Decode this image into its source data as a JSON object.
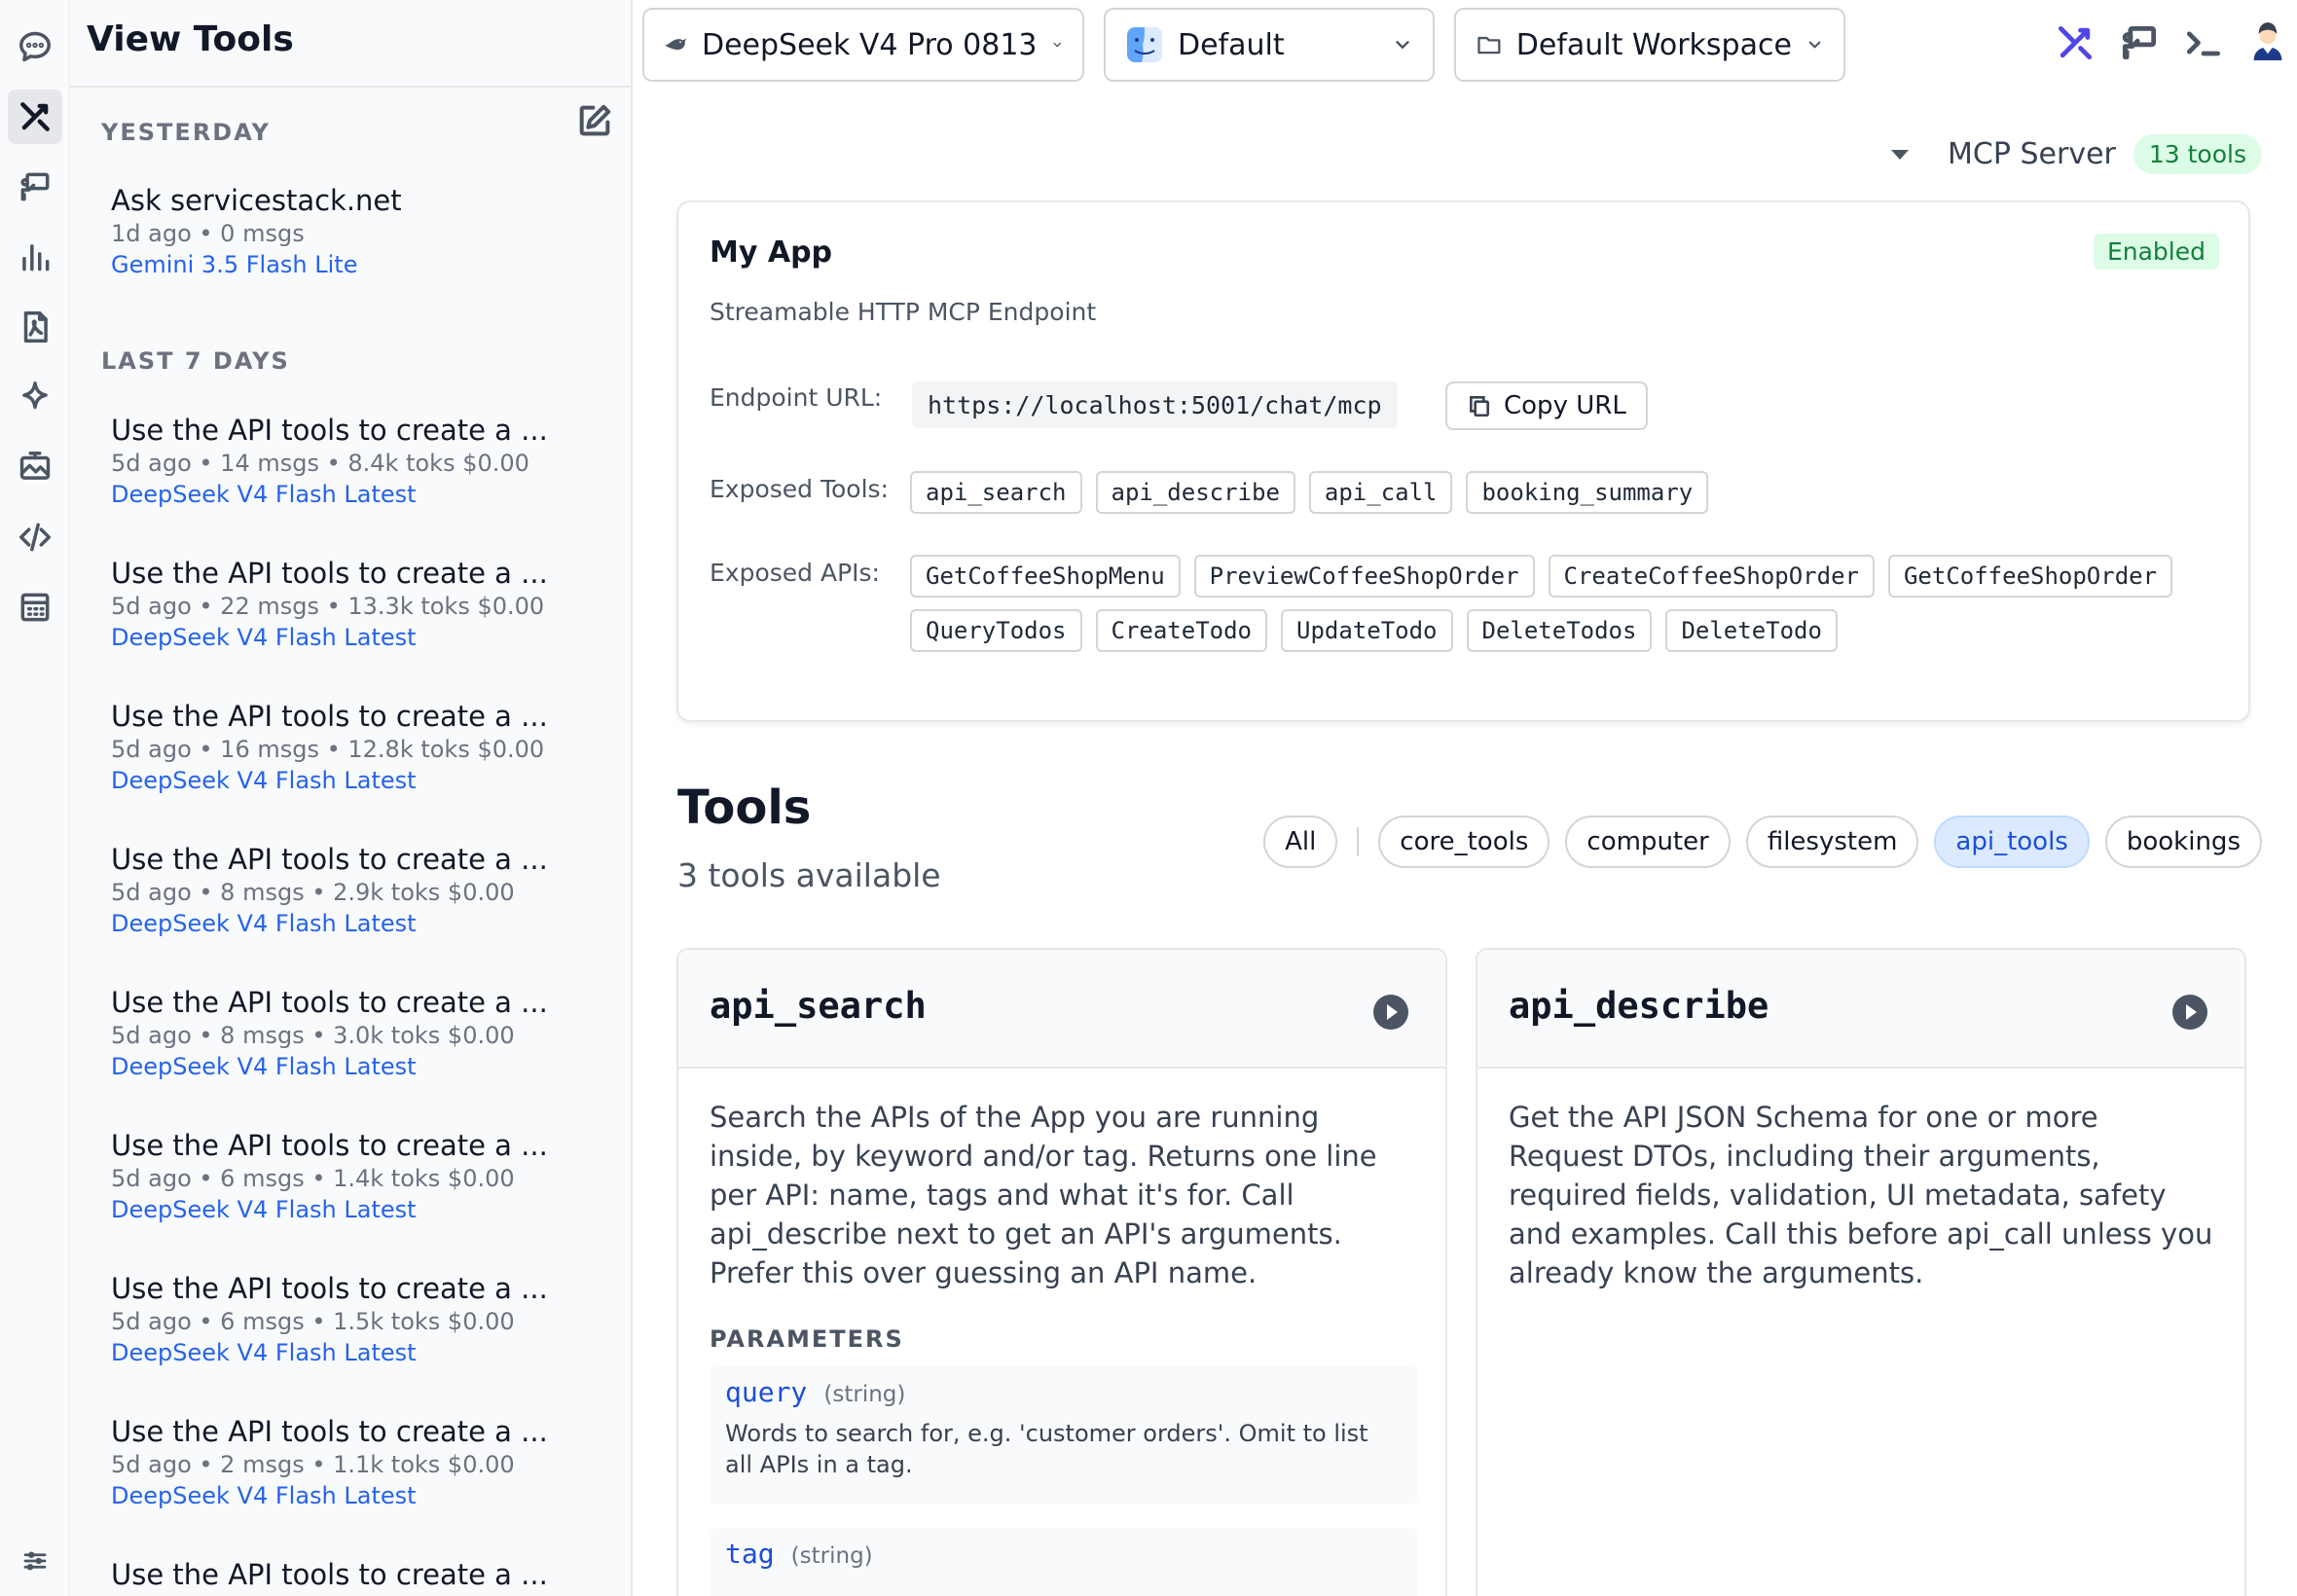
{
  "sidebar": {
    "title": "View Tools",
    "groups": [
      {
        "label": "YESTERDAY"
      },
      {
        "label": "LAST 7 DAYS"
      }
    ],
    "threads": [
      {
        "title": "Ask servicestack.net",
        "meta": "1d ago • 0 msgs",
        "model": "Gemini 3.5 Flash Lite"
      },
      {
        "title": "Use the API tools to create a ...",
        "meta": "5d ago • 14 msgs • 8.4k toks $0.00",
        "model": "DeepSeek V4 Flash Latest"
      },
      {
        "title": "Use the API tools to create a ...",
        "meta": "5d ago • 22 msgs • 13.3k toks $0.00",
        "model": "DeepSeek V4 Flash Latest"
      },
      {
        "title": "Use the API tools to create a ...",
        "meta": "5d ago • 16 msgs • 12.8k toks $0.00",
        "model": "DeepSeek V4 Flash Latest"
      },
      {
        "title": "Use the API tools to create a ...",
        "meta": "5d ago • 8 msgs • 2.9k toks $0.00",
        "model": "DeepSeek V4 Flash Latest"
      },
      {
        "title": "Use the API tools to create a ...",
        "meta": "5d ago • 8 msgs • 3.0k toks $0.00",
        "model": "DeepSeek V4 Flash Latest"
      },
      {
        "title": "Use the API tools to create a ...",
        "meta": "5d ago • 6 msgs • 1.4k toks $0.00",
        "model": "DeepSeek V4 Flash Latest"
      },
      {
        "title": "Use the API tools to create a ...",
        "meta": "5d ago • 6 msgs • 1.5k toks $0.00",
        "model": "DeepSeek V4 Flash Latest"
      },
      {
        "title": "Use the API tools to create a ...",
        "meta": "5d ago • 2 msgs • 1.1k toks $0.00",
        "model": "DeepSeek V4 Flash Latest"
      },
      {
        "title": "Use the API tools to create a ...",
        "meta": "",
        "model": ""
      }
    ]
  },
  "rail": {
    "icons": [
      "chat-bubble-icon",
      "tools-icon",
      "presentation-icon",
      "bar-chart-icon",
      "pdf-icon",
      "sparkle-icon",
      "image-icon",
      "code-icon",
      "calendar-icon",
      "sliders-icon"
    ],
    "active": "tools-icon"
  },
  "topbar": {
    "model": "DeepSeek V4 Pro 0813",
    "profile": "Default",
    "workspace": "Default Workspace",
    "icons": [
      "tools-icon",
      "presentation-icon",
      "terminal-icon",
      "user-avatar-icon"
    ],
    "accent": "#4f46e5"
  },
  "mcp": {
    "label": "MCP Server",
    "count": "13 tools"
  },
  "app": {
    "name": "My App",
    "status": "Enabled",
    "description": "Streamable HTTP MCP Endpoint",
    "endpoint_label": "Endpoint URL:",
    "endpoint_url": "https://localhost:5001/chat/mcp",
    "copy_label": "Copy URL",
    "tools_label": "Exposed Tools:",
    "tools": [
      "api_search",
      "api_describe",
      "api_call",
      "booking_summary"
    ],
    "apis_label": "Exposed APIs:",
    "apis": [
      "GetCoffeeShopMenu",
      "PreviewCoffeeShopOrder",
      "CreateCoffeeShopOrder",
      "GetCoffeeShopOrder",
      "QueryTodos",
      "CreateTodo",
      "UpdateTodo",
      "DeleteTodos",
      "DeleteTodo"
    ]
  },
  "tools": {
    "title": "Tools",
    "count": "3 tools available",
    "filters": [
      "All",
      "core_tools",
      "computer",
      "filesystem",
      "api_tools",
      "bookings"
    ],
    "active_filter": "api_tools",
    "cards": [
      {
        "name": "api_search",
        "description": "Search the APIs of the App you are running inside, by keyword and/or tag. Returns one line per API: name, tags and what it's for. Call api_describe next to get an API's arguments. Prefer this over guessing an API name.",
        "params_label": "PARAMETERS",
        "params": [
          {
            "name": "query",
            "type": "(string)",
            "description": "Words to search for, e.g. 'customer orders'. Omit to list all APIs in a tag."
          },
          {
            "name": "tag",
            "type": "(string)",
            "description": ""
          }
        ]
      },
      {
        "name": "api_describe",
        "description": "Get the API JSON Schema for one or more Request DTOs, including their arguments, required fields, validation, UI metadata, safety and examples. Call this before api_call unless you already know the arguments."
      }
    ]
  },
  "colors": {
    "link": "#2563eb",
    "success_bg": "#dcfce7",
    "success_text": "#15803d",
    "active_filter_bg": "#dbeafe",
    "active_filter_text": "#1d4ed8"
  }
}
